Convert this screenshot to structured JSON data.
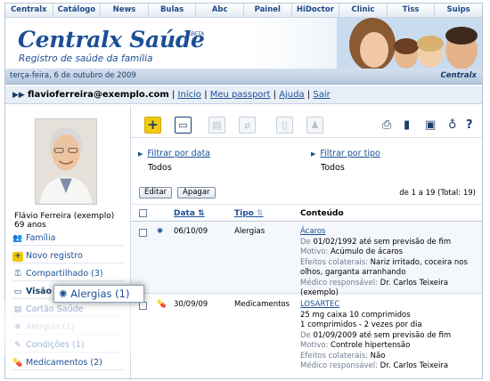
{
  "nav": [
    "Centralx",
    "Catálogo",
    "News",
    "Bulas",
    "Abc",
    "Painel",
    "HiDoctor",
    "Clinic",
    "Tiss",
    "Suips"
  ],
  "banner": {
    "title": "Centralx Saúde",
    "beta": "BETA",
    "subtitle": "Registro de saúde da família"
  },
  "datebar": {
    "date": "terça-feira, 6 de outubro de 2009",
    "brand": "Centralx"
  },
  "userbar": {
    "arrows": "▶▶",
    "email": "flavioferreira@exemplo.com",
    "links": [
      "Início",
      "Meu passport",
      "Ajuda",
      "Sair"
    ]
  },
  "profile": {
    "name": "Flávio Ferreira (exemplo)",
    "age": "69 anos"
  },
  "sidebar": {
    "items": [
      {
        "label": "Família",
        "icon": "family-icon"
      },
      {
        "label": "Novo registro",
        "icon": "plus-icon"
      },
      {
        "label": "Compartilhado (3)",
        "icon": "key-icon"
      },
      {
        "label": "Visão geral",
        "icon": "folder-icon"
      },
      {
        "label": "Cartão Saúde",
        "icon": "card-icon"
      },
      {
        "label": "Alergias (1)",
        "icon": "allergy-icon"
      },
      {
        "label": "Condições (1)",
        "icon": "condition-icon"
      },
      {
        "label": "Medicamentos (2)",
        "icon": "pill-icon"
      }
    ]
  },
  "filters": {
    "date_link": "Filtrar por data",
    "date_value": "Todos",
    "type_link": "Filtrar por tipo",
    "type_value": "Todos"
  },
  "actions": {
    "edit": "Editar",
    "delete": "Apagar",
    "paging": "de 1 a 19 (Total: 19)"
  },
  "table": {
    "headers": {
      "date": "Data",
      "type": "Tipo",
      "content": "Conteúdo"
    },
    "rows": [
      {
        "date": "06/10/09",
        "type": "Alergias",
        "title": "Ácaros",
        "lines": [
          "De 01/02/1992 até sem previsão de fim",
          "Motivo: Acúmulo de ácaros",
          "Efeitos colaterais: Nariz irritado, coceira nos olhos, garganta arranhando",
          "Médico responsável: Dr. Carlos Teixeira (exemplo)"
        ]
      },
      {
        "date": "30/09/09",
        "type": "Medicamentos",
        "title": "LOSARTEC",
        "lines": [
          "25 mg caixa 10 comprimidos",
          "1 comprimidos - 2 vezes por dia",
          "De 01/09/2009 até sem previsão de fim",
          "Motivo: Controle hipertensão",
          "Efeitos colaterais: Não",
          "Médico responsável: Dr. Carlos Teixeira"
        ]
      }
    ]
  },
  "callout": {
    "label": "Alergias (1)"
  },
  "colors": {
    "brand": "#1b4f96",
    "accent": "#f2c90c"
  }
}
